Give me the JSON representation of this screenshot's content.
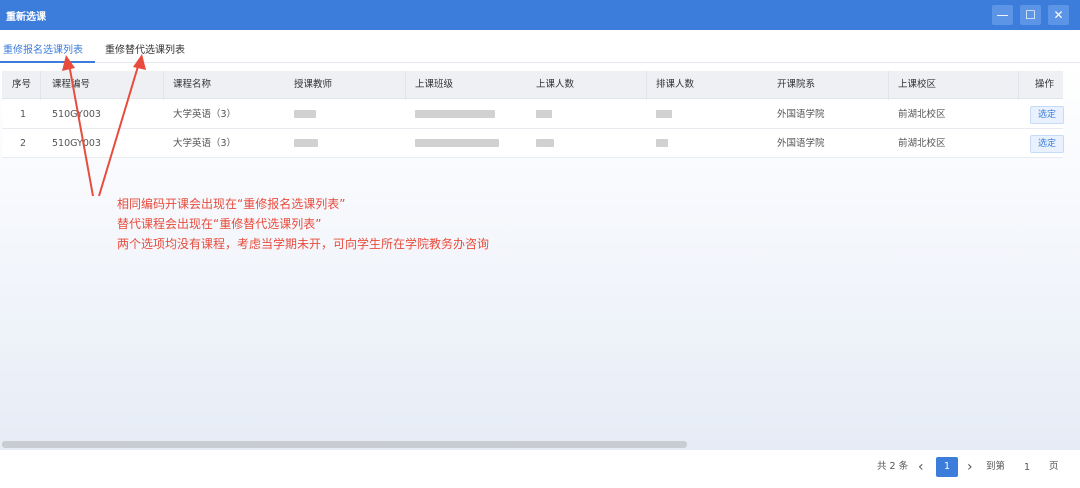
{
  "window": {
    "title": "重新选课",
    "minimize": "—",
    "maximize": "☐",
    "close": "✕"
  },
  "tabs": [
    {
      "label": "重修报名选课列表",
      "active": true
    },
    {
      "label": "重修替代选课列表",
      "active": false
    }
  ],
  "table": {
    "columns": [
      "序号",
      "课程编号",
      "课程名称",
      "授课教师",
      "上课班级",
      "上课人数",
      "排课人数",
      "开课院系",
      "上课校区",
      "操作"
    ],
    "rows": [
      {
        "index": "1",
        "course_code": "510GY003",
        "course_name": "大学英语（3）",
        "department": "外国语学院",
        "campus": "前湖北校区",
        "action": "选定"
      },
      {
        "index": "2",
        "course_code": "510GY003",
        "course_name": "大学英语（3）",
        "department": "外国语学院",
        "campus": "前湖北校区",
        "action": "选定"
      }
    ]
  },
  "annotation": {
    "line1": "相同编码开课会出现在“重修报名选课列表”",
    "line2": "替代课程会出现在“重修替代选课列表”",
    "line3": "两个选项均没有课程，考虑当学期未开，可向学生所在学院教务办咨询",
    "color": "#e84c3d"
  },
  "pagination": {
    "total": "共 2 条",
    "prev": "‹",
    "current": "1",
    "next": "›",
    "goto_label": "到第",
    "goto_value": "1",
    "page_unit": "页"
  },
  "colors": {
    "accent": "#3c7ddc"
  }
}
